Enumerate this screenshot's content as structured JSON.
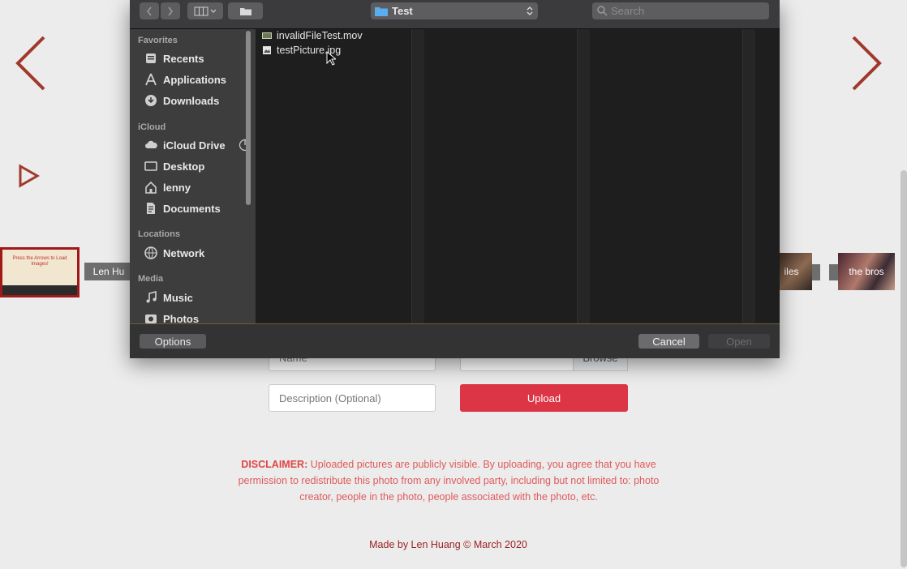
{
  "page": {
    "thumbnails": [
      {
        "label": "Len Hu"
      },
      {
        "label": "iles"
      },
      {
        "label": "the bros"
      }
    ],
    "form": {
      "name_placeholder": "Name",
      "browse_label": "Browse",
      "description_placeholder": "Description (Optional)",
      "upload_label": "Upload"
    },
    "disclaimer": {
      "lead": "DISCLAIMER:",
      "text": "Uploaded pictures are publicly visible. By uploading, you agree that you have permission to redistribute this photo from any involved party, including but not limited to: photo creator, people in the photo, people associated with the photo, etc."
    },
    "footer": "Made by Len Huang © March 2020",
    "selected_thumb_text": "Press the Arrows to Load Images!"
  },
  "dialog": {
    "path": "Test",
    "search_placeholder": "Search",
    "sidebar": {
      "sections": [
        {
          "title": "Favorites",
          "items": [
            {
              "label": "Recents",
              "icon": "recents-icon"
            },
            {
              "label": "Applications",
              "icon": "applications-icon"
            },
            {
              "label": "Downloads",
              "icon": "downloads-icon"
            }
          ]
        },
        {
          "title": "iCloud",
          "items": [
            {
              "label": "iCloud Drive",
              "icon": "cloud-icon"
            },
            {
              "label": "Desktop",
              "icon": "desktop-icon"
            },
            {
              "label": "lenny",
              "icon": "home-icon"
            },
            {
              "label": "Documents",
              "icon": "documents-icon"
            }
          ]
        },
        {
          "title": "Locations",
          "items": [
            {
              "label": "Network",
              "icon": "network-icon"
            }
          ]
        },
        {
          "title": "Media",
          "items": [
            {
              "label": "Music",
              "icon": "music-icon"
            },
            {
              "label": "Photos",
              "icon": "photos-icon"
            }
          ]
        }
      ]
    },
    "files": [
      {
        "name": "invalidFileTest.mov",
        "icon": "movie-file-icon"
      },
      {
        "name": "testPicture.jpg",
        "icon": "image-file-icon"
      }
    ],
    "buttons": {
      "options": "Options",
      "cancel": "Cancel",
      "open": "Open"
    }
  },
  "colors": {
    "arrow": "#a0392b",
    "upload": "#dc3545",
    "footer": "#9a1f1f",
    "disclaimer": "#e05a5a"
  }
}
